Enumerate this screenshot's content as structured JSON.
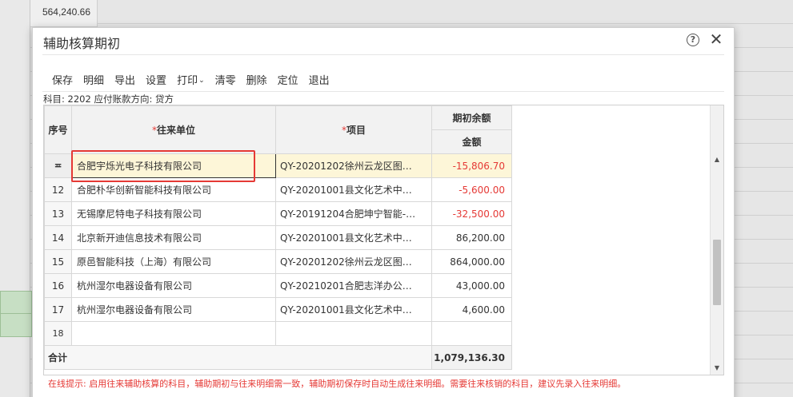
{
  "background": {
    "cell_value": "564,240.66"
  },
  "dialog": {
    "title": "辅助核算期初",
    "help_symbol": "?",
    "close_symbol": "✕"
  },
  "toolbar": {
    "save": "保存",
    "detail": "明细",
    "export": "导出",
    "settings": "设置",
    "print": "打印",
    "print_chevron": "⌄",
    "clear": "清零",
    "delete": "删除",
    "locate": "定位",
    "exit": "退出"
  },
  "info": {
    "text": "科目: 2202 应付账款方向: 贷方"
  },
  "table": {
    "headers": {
      "index": "序号",
      "required_mark": "*",
      "unit": "往来单位",
      "project": "项目",
      "opening_balance": "期初余额",
      "amount": "金额"
    },
    "rows": [
      {
        "index": "",
        "edit_icon": "≖",
        "unit": "合肥宇烁光电子科技有限公司",
        "project": "QY-20201202徐州云龙区图…",
        "amount": "-15,806.70",
        "negative": true
      },
      {
        "index": "12",
        "unit": "合肥朴华创新智能科技有限公司",
        "project": "QY-20201001县文化艺术中…",
        "amount": "-5,600.00",
        "negative": true
      },
      {
        "index": "13",
        "unit": "无锡摩尼特电子科技有限公司",
        "project": "QY-20191204合肥坤宁智能-…",
        "amount": "-32,500.00",
        "negative": true
      },
      {
        "index": "14",
        "unit": "北京新开迪信息技术有限公司",
        "project": "QY-20201001县文化艺术中…",
        "amount": "86,200.00",
        "negative": false
      },
      {
        "index": "15",
        "unit": "原邑智能科技（上海）有限公司",
        "project": "QY-20201202徐州云龙区图…",
        "amount": "864,000.00",
        "negative": false
      },
      {
        "index": "16",
        "unit": "杭州湿尔电器设备有限公司",
        "project": "QY-20210201合肥志洋办公…",
        "amount": "43,000.00",
        "negative": false
      },
      {
        "index": "17",
        "unit": "杭州湿尔电器设备有限公司",
        "project": "QY-20201001县文化艺术中…",
        "amount": "4,600.00",
        "negative": false
      },
      {
        "index": "18",
        "unit": "",
        "project": "",
        "amount": "",
        "negative": false
      }
    ],
    "total_label": "合计",
    "total_amount": "1,079,136.30"
  },
  "scrollbar": {
    "up_arrow": "▲",
    "down_arrow": "▼"
  },
  "tip": {
    "text": "在线提示: 启用往来辅助核算的科目，辅助期初与往来明细需一致，辅助期初保存时自动生成往来明细。需要往来核销的科目，建议先录入往来明细。"
  },
  "colors": {
    "negative": "#e53935",
    "highlight_box": "#e53935",
    "selected_row": "#fdf6d8"
  }
}
